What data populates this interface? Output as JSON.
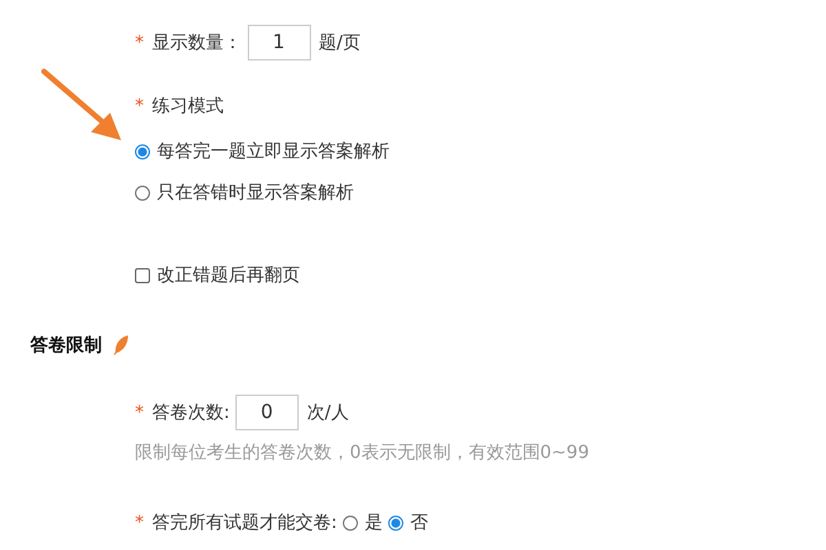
{
  "display_count": {
    "required_mark": "*",
    "label": "显示数量：",
    "value": "1",
    "unit": "题/页"
  },
  "practice_mode": {
    "required_mark": "*",
    "label": "练习模式",
    "options": [
      {
        "label": "每答完一题立即显示答案解析",
        "selected": true
      },
      {
        "label": "只在答错时显示答案解析",
        "selected": false
      }
    ]
  },
  "turn_page": {
    "label": "改正错题后再翻页",
    "checked": false
  },
  "section": {
    "title": "答卷限制"
  },
  "attempts": {
    "required_mark": "*",
    "label": "答卷次数:",
    "value": "0",
    "unit": "次/人",
    "hint": "限制每位考生的答卷次数，0表示无限制，有效范围0~99"
  },
  "must_answer_all": {
    "required_mark": "*",
    "label": "答完所有试题才能交卷:",
    "options": [
      {
        "label": "是",
        "selected": false
      },
      {
        "label": "否",
        "selected": true
      }
    ]
  }
}
